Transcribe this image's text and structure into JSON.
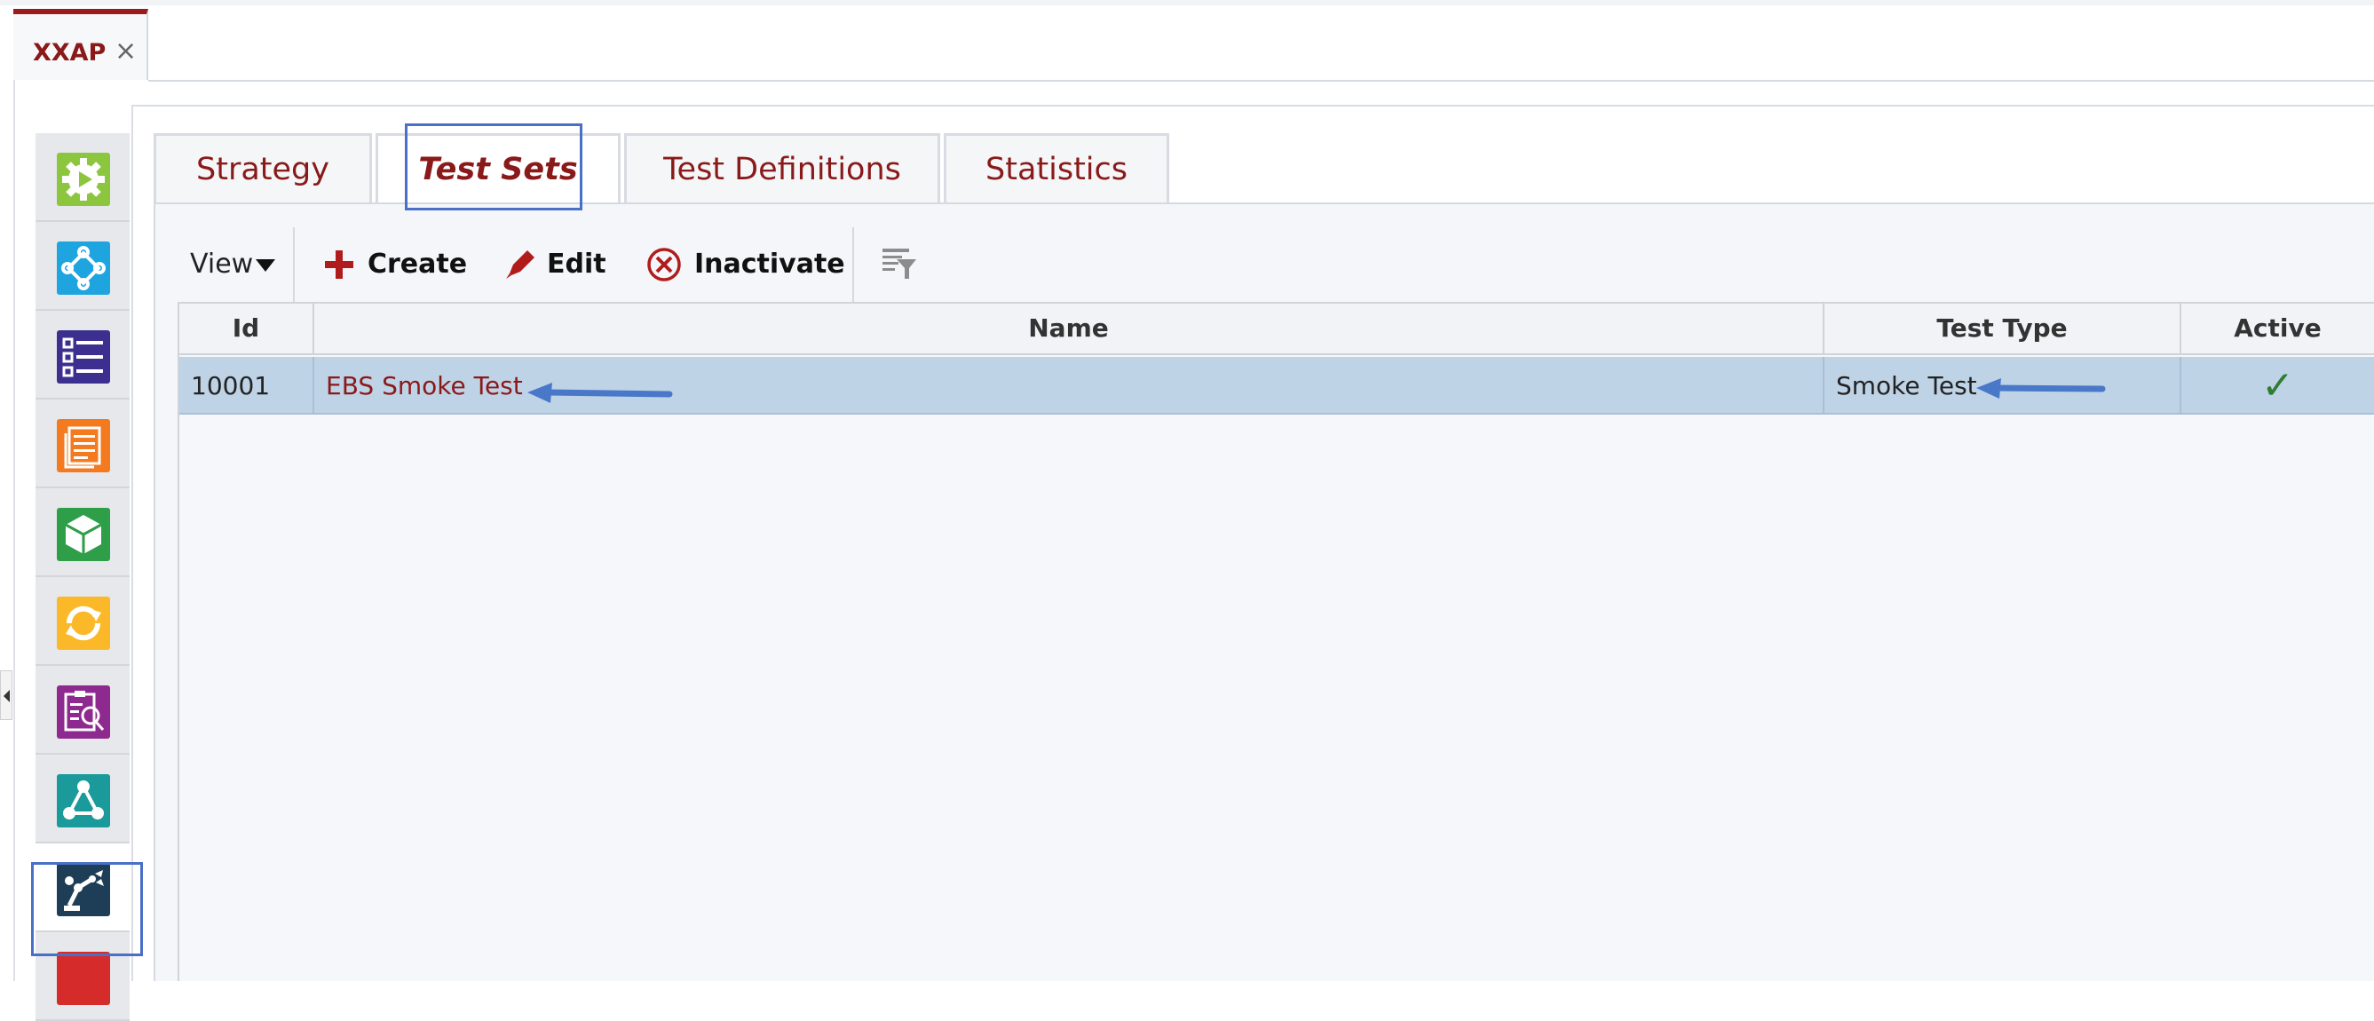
{
  "app": {
    "doc_tab": {
      "label": "XXAP",
      "close_glyph": "×"
    }
  },
  "sidebar": {
    "items": [
      {
        "icon": "gear-play-icon",
        "color": "#8cc63f"
      },
      {
        "icon": "flow-diamond-icon",
        "color": "#1ea5e0"
      },
      {
        "icon": "checklist-icon",
        "color": "#3b2f8f"
      },
      {
        "icon": "document-stack-icon",
        "color": "#f47a20"
      },
      {
        "icon": "cube-icon",
        "color": "#2e9e48"
      },
      {
        "icon": "refresh-cycle-icon",
        "color": "#fbb829"
      },
      {
        "icon": "clipboard-search-icon",
        "color": "#8e2a8f"
      },
      {
        "icon": "network-graph-icon",
        "color": "#1b9a9c"
      },
      {
        "icon": "robot-arm-icon",
        "color": "#1e3e57",
        "selected": true
      },
      {
        "icon": "partial-red-icon",
        "color": "#d62b2b"
      }
    ]
  },
  "tabs": [
    {
      "label": "Strategy",
      "active": false
    },
    {
      "label": "Test Sets",
      "active": true
    },
    {
      "label": "Test Definitions",
      "active": false
    },
    {
      "label": "Statistics",
      "active": false
    }
  ],
  "toolbar": {
    "view_label": "View",
    "create_label": "Create",
    "edit_label": "Edit",
    "inactivate_label": "Inactivate",
    "filter_icon": "filter-columns-icon"
  },
  "table": {
    "columns": [
      "Id",
      "Name",
      "Test Type",
      "Active"
    ],
    "rows": [
      {
        "id": "10001",
        "name": "EBS Smoke Test",
        "test_type": "Smoke Test",
        "active": "✓"
      }
    ]
  },
  "colors": {
    "brand_red": "#8a1a1a",
    "selection_row": "#bfd3e6",
    "highlight_box": "#4a6fc7",
    "annotation_arrow": "#4a78c9",
    "checkmark": "#2e7d32"
  }
}
